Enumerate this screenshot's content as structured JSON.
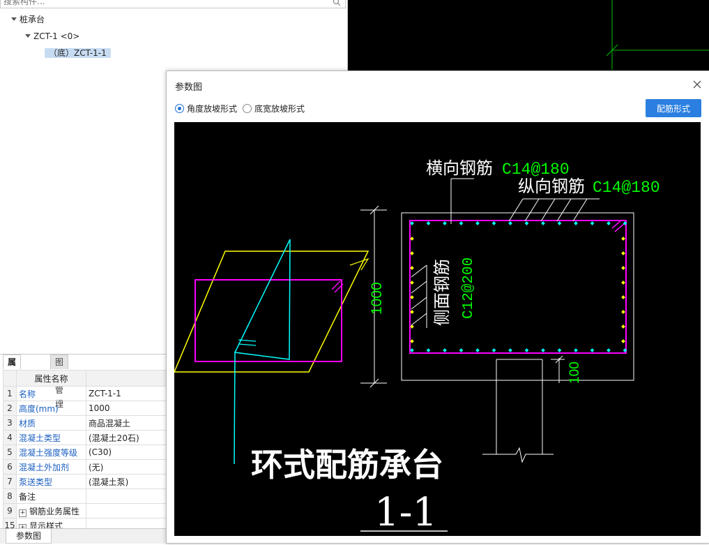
{
  "search": {
    "placeholder": "搜索构件..."
  },
  "tree": {
    "root": "桩承台",
    "child": "ZCT-1 <0>",
    "leaf": "（底）ZCT-1-1"
  },
  "props": {
    "tabs": [
      "属性列表",
      "图层管理"
    ],
    "header": "属性名称",
    "rows": [
      {
        "idx": "1",
        "name": "名称",
        "value": "ZCT-1-1"
      },
      {
        "idx": "2",
        "name": "高度(mm)",
        "value": "1000"
      },
      {
        "idx": "3",
        "name": "材质",
        "value": "商品混凝土"
      },
      {
        "idx": "4",
        "name": "混凝土类型",
        "value": "(混凝土20石)"
      },
      {
        "idx": "5",
        "name": "混凝土强度等级",
        "value": "(C30)"
      },
      {
        "idx": "6",
        "name": "混凝土外加剂",
        "value": "(无)"
      },
      {
        "idx": "7",
        "name": "泵送类型",
        "value": "(混凝土泵)"
      },
      {
        "idx": "8",
        "name": "备注",
        "value": ""
      },
      {
        "idx": "9",
        "name": "钢筋业务属性",
        "value": ""
      },
      {
        "idx": "15",
        "name": "显示样式",
        "value": ""
      }
    ]
  },
  "bottom_tab": "参数图",
  "dialog": {
    "title": "参数图",
    "radio_angle": "角度放坡形式",
    "radio_width": "底宽放坡形式",
    "button": "配筋形式"
  },
  "drawing": {
    "transverse_label": "横向钢筋",
    "transverse_value": "C14@180",
    "longitudinal_label": "纵向钢筋",
    "longitudinal_value": "C14@180",
    "side_label": "侧面钢筋",
    "side_value": "C12@200",
    "dim_height": "1000",
    "dim_bottom": "100",
    "caption": "环式配筋承台",
    "section": "1-1"
  },
  "colors": {
    "magenta": "#ff00ff",
    "cyan": "#00ffff",
    "yellow": "#ffff00",
    "green": "#00ff00",
    "white": "#ffffff",
    "accent": "#2a7fe0"
  }
}
